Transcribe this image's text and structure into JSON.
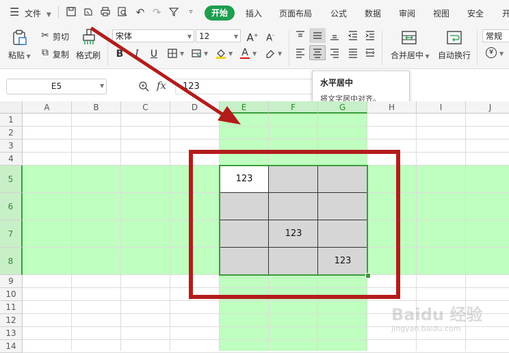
{
  "menu": {
    "file_label": "文件",
    "tabs": [
      "开始",
      "插入",
      "页面布局",
      "公式",
      "数据",
      "审阅",
      "视图",
      "安全",
      "开"
    ],
    "active_tab": "开始"
  },
  "ribbon": {
    "paste_label": "粘贴",
    "cut_label": "剪切",
    "copy_label": "复制",
    "format_painter_label": "格式刷",
    "font_name": "宋体",
    "font_size": "12",
    "merge_center_label": "合并居中",
    "wrap_text_label": "自动换行",
    "number_format": "常规",
    "currency_symbol": "¥"
  },
  "tooltip": {
    "title": "水平居中",
    "description": "将文字居中对齐。"
  },
  "formula_bar": {
    "cell_name": "E5",
    "fx_label": "fx",
    "value": "123"
  },
  "grid": {
    "columns": [
      "A",
      "B",
      "C",
      "D",
      "E",
      "F",
      "G",
      "H",
      "I",
      "J"
    ],
    "selected_columns": [
      "E",
      "F",
      "G"
    ],
    "rows": [
      "1",
      "2",
      "3",
      "4",
      "5",
      "6",
      "7",
      "8",
      "9",
      "10",
      "11",
      "12",
      "13",
      "14"
    ],
    "selected_rows": [
      "5",
      "6",
      "7",
      "8"
    ],
    "cells": [
      {
        "ref": "E5",
        "value": "123"
      },
      {
        "ref": "F7",
        "value": "123"
      },
      {
        "ref": "G8",
        "value": "123"
      }
    ]
  },
  "colors": {
    "accent_green": "#1e9e4f",
    "selection_green": "#bfffbf",
    "annotation_red": "#b31c1c",
    "range_fill": "#d6d6d6"
  },
  "watermark": {
    "text": "Baidu 经验",
    "sub": "jingyan.baidu.com"
  }
}
